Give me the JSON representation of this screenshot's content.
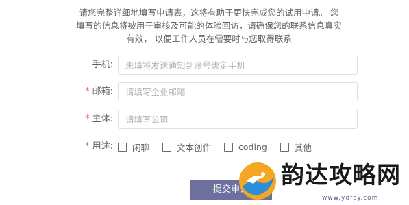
{
  "intro_text": "请您完整详细地填写申请表，这将有助于更快完成您的试用申请。 您填写的信息将被用于审核及可能的体验回访，请确保您的联系信息真实有效， 以便工作人员在需要时与您取得联系",
  "form": {
    "phone": {
      "required": false,
      "label": "手机:",
      "value": "",
      "placeholder": "未填将发送通知到账号绑定手机"
    },
    "email": {
      "required": true,
      "required_mark": "*",
      "label": "邮箱:",
      "value": "",
      "placeholder": "请填写企业邮箱"
    },
    "subject": {
      "required": true,
      "required_mark": "*",
      "label": "主体:",
      "value": "",
      "placeholder": "请填写公司"
    },
    "purpose": {
      "required": true,
      "required_mark": "*",
      "label": "用途:",
      "options": [
        {
          "label": "闲聊",
          "checked": false
        },
        {
          "label": "文本创作",
          "checked": false
        },
        {
          "label": "coding",
          "checked": false
        },
        {
          "label": "其他",
          "checked": false
        }
      ]
    },
    "submit_label": "提交申请"
  },
  "watermark": {
    "text": "韵达攻略网",
    "url": "www.ydfcy.com",
    "logo_icon": "bird-logo-icon"
  },
  "colors": {
    "required": "#f56c6c",
    "button_bg": "#6d6f9c",
    "input_border": "#dcdfe6"
  }
}
